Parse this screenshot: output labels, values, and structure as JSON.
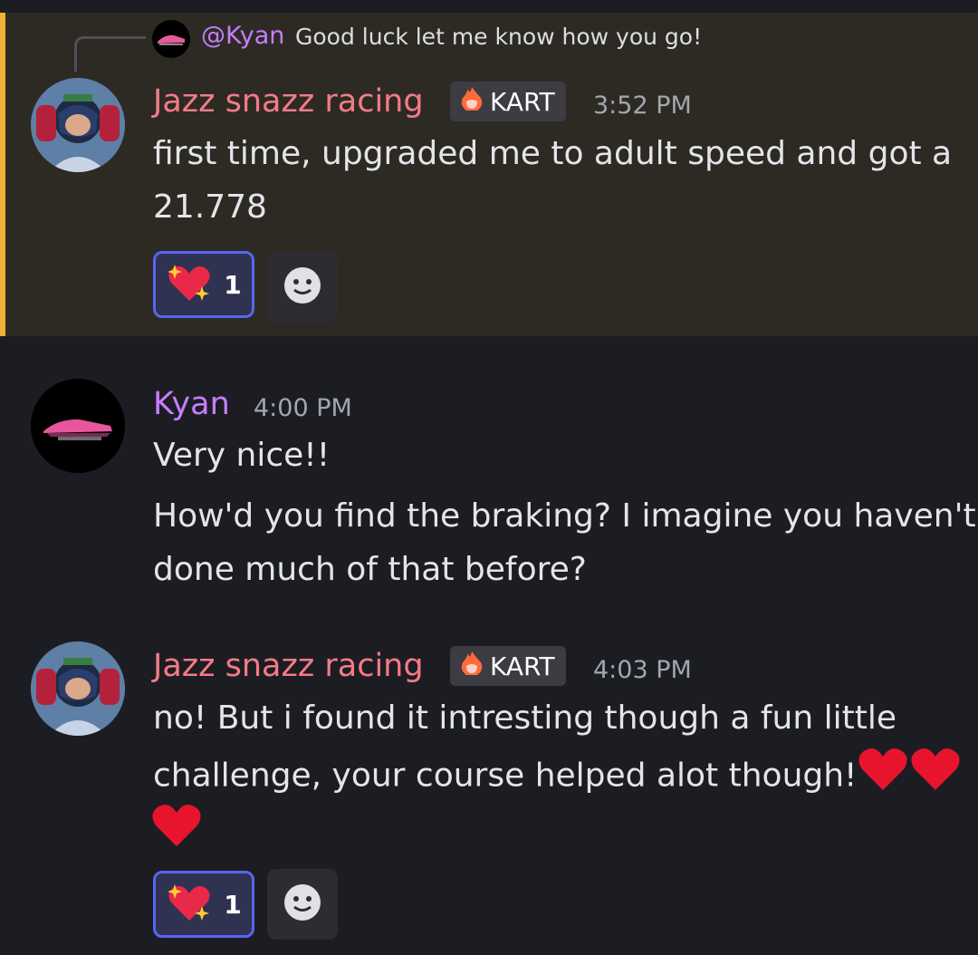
{
  "reply": {
    "mention": "@Kyan",
    "text": "Good luck let me know how you go!"
  },
  "messages": [
    {
      "author": "Jazz snazz racing",
      "tag": "KART",
      "time": "3:52 PM",
      "lines": [
        "first time, upgraded me to adult speed and got a",
        "21.778"
      ],
      "reaction": {
        "emoji": "sparkling-heart",
        "count": "1"
      }
    },
    {
      "author": "Kyan",
      "time": "4:00 PM",
      "lines": [
        "Very nice!!",
        "How'd you find the braking? I imagine you haven't",
        "done much of that before?"
      ]
    },
    {
      "author": "Jazz snazz racing",
      "tag": "KART",
      "time": "4:03 PM",
      "lines": [
        "no! But i found it intresting though a fun little",
        "challenge, your course helped alot though!"
      ],
      "reaction": {
        "emoji": "sparkling-heart",
        "count": "1"
      }
    }
  ],
  "colors": {
    "background": "#1c1d23",
    "highlight": "#2d2a24",
    "highlight_bar": "#f0b232",
    "jazz_name": "#f47b86",
    "kyan_name": "#c77dff",
    "reaction_border": "#5865f2"
  }
}
